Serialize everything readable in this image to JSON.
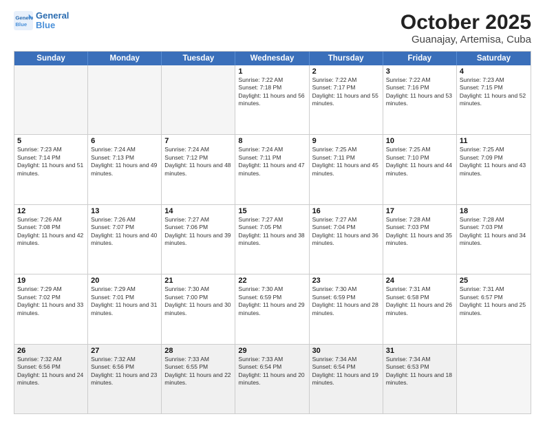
{
  "logo": {
    "line1": "General",
    "line2": "Blue"
  },
  "title": "October 2025",
  "subtitle": "Guanajay, Artemisa, Cuba",
  "weekdays": [
    "Sunday",
    "Monday",
    "Tuesday",
    "Wednesday",
    "Thursday",
    "Friday",
    "Saturday"
  ],
  "rows": [
    [
      {
        "day": "",
        "info": "",
        "empty": true
      },
      {
        "day": "",
        "info": "",
        "empty": true
      },
      {
        "day": "",
        "info": "",
        "empty": true
      },
      {
        "day": "1",
        "info": "Sunrise: 7:22 AM\nSunset: 7:18 PM\nDaylight: 11 hours and 56 minutes."
      },
      {
        "day": "2",
        "info": "Sunrise: 7:22 AM\nSunset: 7:17 PM\nDaylight: 11 hours and 55 minutes."
      },
      {
        "day": "3",
        "info": "Sunrise: 7:22 AM\nSunset: 7:16 PM\nDaylight: 11 hours and 53 minutes."
      },
      {
        "day": "4",
        "info": "Sunrise: 7:23 AM\nSunset: 7:15 PM\nDaylight: 11 hours and 52 minutes."
      }
    ],
    [
      {
        "day": "5",
        "info": "Sunrise: 7:23 AM\nSunset: 7:14 PM\nDaylight: 11 hours and 51 minutes."
      },
      {
        "day": "6",
        "info": "Sunrise: 7:24 AM\nSunset: 7:13 PM\nDaylight: 11 hours and 49 minutes."
      },
      {
        "day": "7",
        "info": "Sunrise: 7:24 AM\nSunset: 7:12 PM\nDaylight: 11 hours and 48 minutes."
      },
      {
        "day": "8",
        "info": "Sunrise: 7:24 AM\nSunset: 7:11 PM\nDaylight: 11 hours and 47 minutes."
      },
      {
        "day": "9",
        "info": "Sunrise: 7:25 AM\nSunset: 7:11 PM\nDaylight: 11 hours and 45 minutes."
      },
      {
        "day": "10",
        "info": "Sunrise: 7:25 AM\nSunset: 7:10 PM\nDaylight: 11 hours and 44 minutes."
      },
      {
        "day": "11",
        "info": "Sunrise: 7:25 AM\nSunset: 7:09 PM\nDaylight: 11 hours and 43 minutes."
      }
    ],
    [
      {
        "day": "12",
        "info": "Sunrise: 7:26 AM\nSunset: 7:08 PM\nDaylight: 11 hours and 42 minutes."
      },
      {
        "day": "13",
        "info": "Sunrise: 7:26 AM\nSunset: 7:07 PM\nDaylight: 11 hours and 40 minutes."
      },
      {
        "day": "14",
        "info": "Sunrise: 7:27 AM\nSunset: 7:06 PM\nDaylight: 11 hours and 39 minutes."
      },
      {
        "day": "15",
        "info": "Sunrise: 7:27 AM\nSunset: 7:05 PM\nDaylight: 11 hours and 38 minutes."
      },
      {
        "day": "16",
        "info": "Sunrise: 7:27 AM\nSunset: 7:04 PM\nDaylight: 11 hours and 36 minutes."
      },
      {
        "day": "17",
        "info": "Sunrise: 7:28 AM\nSunset: 7:03 PM\nDaylight: 11 hours and 35 minutes."
      },
      {
        "day": "18",
        "info": "Sunrise: 7:28 AM\nSunset: 7:03 PM\nDaylight: 11 hours and 34 minutes."
      }
    ],
    [
      {
        "day": "19",
        "info": "Sunrise: 7:29 AM\nSunset: 7:02 PM\nDaylight: 11 hours and 33 minutes."
      },
      {
        "day": "20",
        "info": "Sunrise: 7:29 AM\nSunset: 7:01 PM\nDaylight: 11 hours and 31 minutes."
      },
      {
        "day": "21",
        "info": "Sunrise: 7:30 AM\nSunset: 7:00 PM\nDaylight: 11 hours and 30 minutes."
      },
      {
        "day": "22",
        "info": "Sunrise: 7:30 AM\nSunset: 6:59 PM\nDaylight: 11 hours and 29 minutes."
      },
      {
        "day": "23",
        "info": "Sunrise: 7:30 AM\nSunset: 6:59 PM\nDaylight: 11 hours and 28 minutes."
      },
      {
        "day": "24",
        "info": "Sunrise: 7:31 AM\nSunset: 6:58 PM\nDaylight: 11 hours and 26 minutes."
      },
      {
        "day": "25",
        "info": "Sunrise: 7:31 AM\nSunset: 6:57 PM\nDaylight: 11 hours and 25 minutes."
      }
    ],
    [
      {
        "day": "26",
        "info": "Sunrise: 7:32 AM\nSunset: 6:56 PM\nDaylight: 11 hours and 24 minutes.",
        "shaded": true
      },
      {
        "day": "27",
        "info": "Sunrise: 7:32 AM\nSunset: 6:56 PM\nDaylight: 11 hours and 23 minutes.",
        "shaded": true
      },
      {
        "day": "28",
        "info": "Sunrise: 7:33 AM\nSunset: 6:55 PM\nDaylight: 11 hours and 22 minutes.",
        "shaded": true
      },
      {
        "day": "29",
        "info": "Sunrise: 7:33 AM\nSunset: 6:54 PM\nDaylight: 11 hours and 20 minutes.",
        "shaded": true
      },
      {
        "day": "30",
        "info": "Sunrise: 7:34 AM\nSunset: 6:54 PM\nDaylight: 11 hours and 19 minutes.",
        "shaded": true
      },
      {
        "day": "31",
        "info": "Sunrise: 7:34 AM\nSunset: 6:53 PM\nDaylight: 11 hours and 18 minutes.",
        "shaded": true
      },
      {
        "day": "",
        "info": "",
        "empty": true,
        "shaded": true
      }
    ]
  ]
}
